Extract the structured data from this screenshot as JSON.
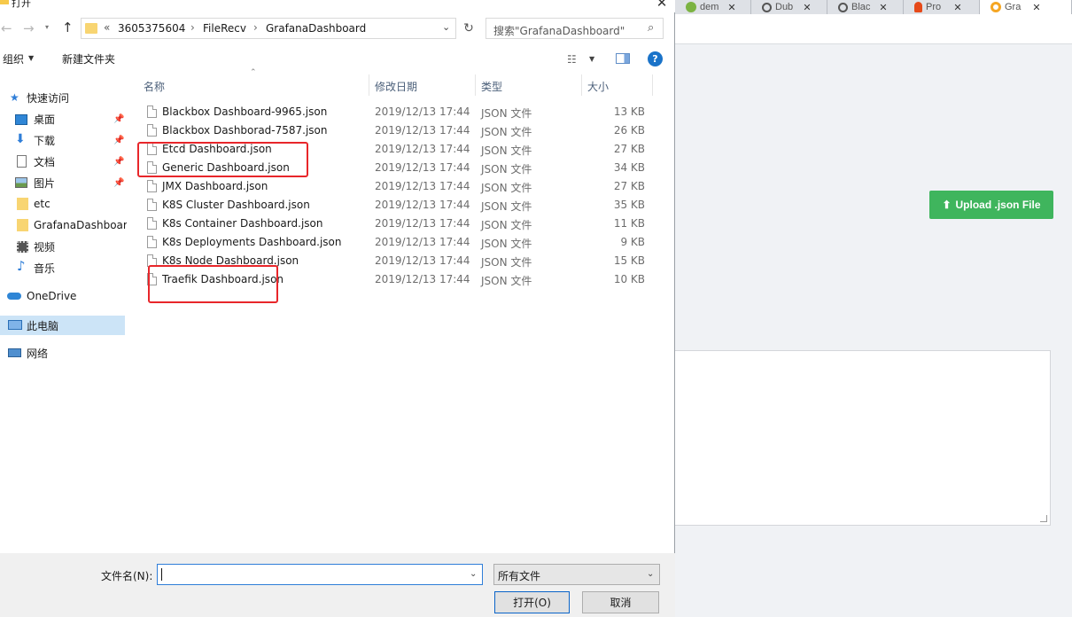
{
  "browser": {
    "tabs": [
      {
        "title": "dem",
        "icon": "leaf-icon",
        "color": "#7cb342"
      },
      {
        "title": "Dub",
        "icon": "globe-icon",
        "color": "#555555"
      },
      {
        "title": "Blac",
        "icon": "globe-icon",
        "color": "#555555"
      },
      {
        "title": "Pro",
        "icon": "torch-icon",
        "color": "#e64a19"
      },
      {
        "title": "Gra",
        "icon": "grafana-icon",
        "color": "#f5a623"
      }
    ],
    "upload_button": "Upload .json File"
  },
  "dialog": {
    "title": "打开",
    "close_glyph": "✕",
    "nav": {
      "back": "←",
      "forward": "→",
      "up": "↑"
    },
    "address": {
      "prefix": "«",
      "crumbs": [
        "3605375604",
        "FileRecv",
        "GrafanaDashboard"
      ],
      "separator": "›",
      "drop_glyph": "⌄",
      "refresh_glyph": "↻"
    },
    "search": {
      "placeholder": "搜索\"GrafanaDashboard\"",
      "icon_glyph": "⌕"
    },
    "commands": {
      "organize": "组织",
      "new_folder": "新建文件夹",
      "help": "?"
    },
    "nav_pane": [
      {
        "label": "快速访问",
        "icon": "star-icon",
        "pinned": false
      },
      {
        "label": "桌面",
        "icon": "desktop-icon",
        "pinned": true
      },
      {
        "label": "下载",
        "icon": "download-icon",
        "pinned": true
      },
      {
        "label": "文档",
        "icon": "document-icon",
        "pinned": true
      },
      {
        "label": "图片",
        "icon": "pictures-icon",
        "pinned": true
      },
      {
        "label": "etc",
        "icon": "folder-icon",
        "pinned": false
      },
      {
        "label": "GrafanaDashboard",
        "icon": "folder-icon",
        "pinned": false
      },
      {
        "label": "视频",
        "icon": "video-icon",
        "pinned": false
      },
      {
        "label": "音乐",
        "icon": "music-icon",
        "pinned": false
      },
      {
        "label": "OneDrive",
        "icon": "cloud-icon",
        "pinned": false
      },
      {
        "label": "此电脑",
        "icon": "computer-icon",
        "pinned": false
      },
      {
        "label": "网络",
        "icon": "network-icon",
        "pinned": false
      }
    ],
    "columns": [
      "名称",
      "修改日期",
      "类型",
      "大小"
    ],
    "files": [
      {
        "name": "Blackbox Dashboard-9965.json",
        "date": "2019/12/13 17:44",
        "type": "JSON 文件",
        "size": "13 KB"
      },
      {
        "name": "Blackbox Dashborad-7587.json",
        "date": "2019/12/13 17:44",
        "type": "JSON 文件",
        "size": "26 KB"
      },
      {
        "name": "Etcd Dashboard.json",
        "date": "2019/12/13 17:44",
        "type": "JSON 文件",
        "size": "27 KB"
      },
      {
        "name": "Generic Dashboard.json",
        "date": "2019/12/13 17:44",
        "type": "JSON 文件",
        "size": "34 KB"
      },
      {
        "name": "JMX Dashboard.json",
        "date": "2019/12/13 17:44",
        "type": "JSON 文件",
        "size": "27 KB"
      },
      {
        "name": "K8S Cluster Dashboard.json",
        "date": "2019/12/13 17:44",
        "type": "JSON 文件",
        "size": "35 KB"
      },
      {
        "name": "K8s Container Dashboard.json",
        "date": "2019/12/13 17:44",
        "type": "JSON 文件",
        "size": "11 KB"
      },
      {
        "name": "K8s Deployments Dashboard.json",
        "date": "2019/12/13 17:44",
        "type": "JSON 文件",
        "size": "9 KB"
      },
      {
        "name": "K8s Node Dashboard.json",
        "date": "2019/12/13 17:44",
        "type": "JSON 文件",
        "size": "15 KB"
      },
      {
        "name": "Traefik Dashboard.json",
        "date": "2019/12/13 17:44",
        "type": "JSON 文件",
        "size": "10 KB"
      }
    ],
    "filename": {
      "label": "文件名(N):",
      "value": ""
    },
    "filetype": {
      "selected": "所有文件"
    },
    "buttons": {
      "open": "打开(O)",
      "cancel": "取消"
    }
  },
  "colors": {
    "accent": "#2f7ed8",
    "highlight": "#e8262a",
    "upload_green": "#3fb55d",
    "selection": "#cce4f7"
  }
}
